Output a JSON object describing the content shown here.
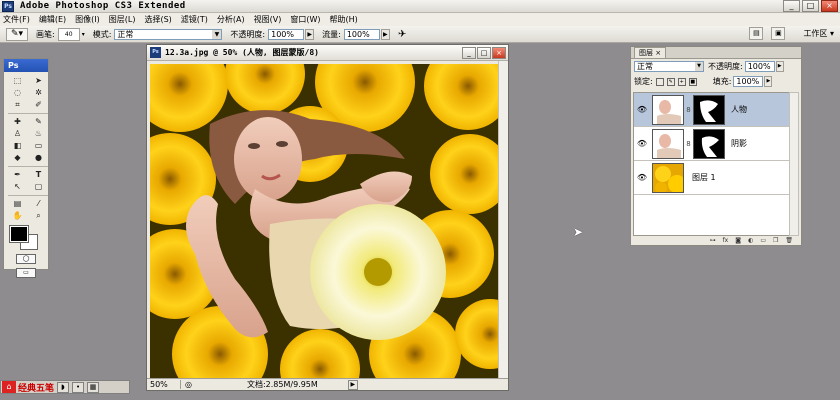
{
  "app": {
    "title": "Adobe Photoshop CS3 Extended",
    "logo": "Ps"
  },
  "window_buttons": [
    "_",
    "□",
    "×"
  ],
  "menu": [
    "文件(F)",
    "编辑(E)",
    "图像(I)",
    "图层(L)",
    "选择(S)",
    "滤镜(T)",
    "分析(A)",
    "视图(V)",
    "窗口(W)",
    "帮助(H)"
  ],
  "options": {
    "brush_label": "画笔:",
    "brush_size": "40",
    "mode_label": "模式:",
    "mode_value": "正常",
    "opacity_label": "不透明度:",
    "opacity_value": "100%",
    "flow_label": "流量:",
    "flow_value": "100%",
    "workspace_label": "工作区 ▾"
  },
  "toolbox": {
    "header": "Ps"
  },
  "document": {
    "title": "12.3a.jpg @ 50% (人物, 图层蒙版/8)",
    "zoom": "50%",
    "info": "文档:2.85M/9.95M"
  },
  "layers": {
    "tab": "图层",
    "tab_close": "×",
    "blend_mode": "正常",
    "opacity_label": "不透明度:",
    "opacity_value": "100%",
    "lock_label": "锁定:",
    "fill_label": "填充:",
    "fill_value": "100%",
    "items": [
      {
        "name": "人物",
        "selected": true
      },
      {
        "name": "阴影",
        "selected": false
      },
      {
        "name": "图层 1",
        "selected": false
      }
    ]
  },
  "taskbar": {
    "ime_label": "经典五笔"
  }
}
